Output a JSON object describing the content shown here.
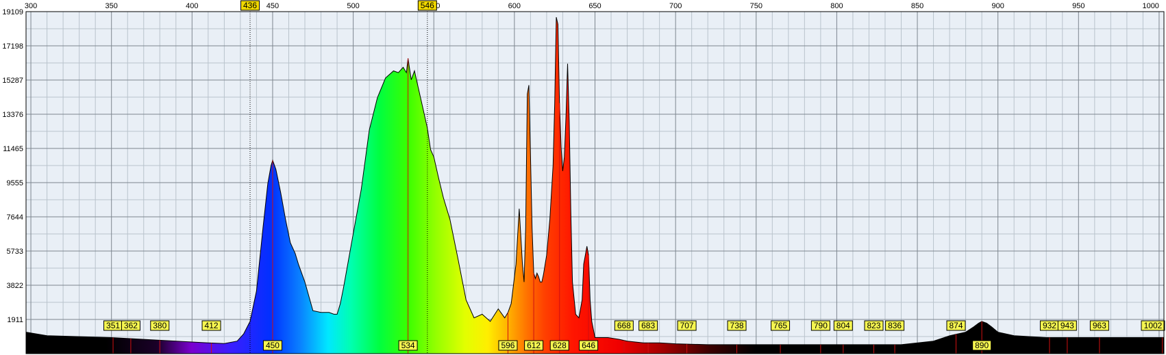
{
  "chart_data": {
    "type": "area",
    "title": "",
    "xlabel": "",
    "ylabel": "",
    "xlim": [
      297,
      1003
    ],
    "ylim": [
      0,
      19109
    ],
    "x_ticks": [
      "300",
      "350",
      "400",
      "450",
      "500",
      "550",
      "600",
      "650",
      "700",
      "750",
      "800",
      "850",
      "900",
      "950",
      "1000"
    ],
    "x_tick_values": [
      300,
      350,
      400,
      450,
      500,
      550,
      600,
      650,
      700,
      750,
      800,
      850,
      900,
      950,
      1000
    ],
    "y_ticks": [
      "1911",
      "3822",
      "5733",
      "7644",
      "9555",
      "11465",
      "13376",
      "15287",
      "17198",
      "19109"
    ],
    "y_tick_values": [
      1911,
      3822,
      5733,
      7644,
      9555,
      11465,
      13376,
      15287,
      17198,
      19109
    ],
    "grid": true,
    "markers": [
      {
        "label": "436",
        "x": 436
      },
      {
        "label": "546",
        "x": 546
      }
    ],
    "peak_labels": [
      {
        "label": "351",
        "x": 351,
        "row": "top"
      },
      {
        "label": "362",
        "x": 362,
        "row": "top"
      },
      {
        "label": "380",
        "x": 380,
        "row": "top"
      },
      {
        "label": "412",
        "x": 412,
        "row": "top"
      },
      {
        "label": "450",
        "x": 450,
        "row": "bottom"
      },
      {
        "label": "534",
        "x": 534,
        "row": "bottom"
      },
      {
        "label": "596",
        "x": 596,
        "row": "bottom"
      },
      {
        "label": "612",
        "x": 612,
        "row": "bottom"
      },
      {
        "label": "628",
        "x": 628,
        "row": "bottom"
      },
      {
        "label": "646",
        "x": 646,
        "row": "bottom"
      },
      {
        "label": "668",
        "x": 668,
        "row": "top"
      },
      {
        "label": "683",
        "x": 683,
        "row": "top"
      },
      {
        "label": "707",
        "x": 707,
        "row": "top"
      },
      {
        "label": "738",
        "x": 738,
        "row": "top"
      },
      {
        "label": "765",
        "x": 765,
        "row": "top"
      },
      {
        "label": "790",
        "x": 790,
        "row": "top"
      },
      {
        "label": "804",
        "x": 804,
        "row": "top"
      },
      {
        "label": "823",
        "x": 823,
        "row": "top"
      },
      {
        "label": "836",
        "x": 836,
        "row": "top"
      },
      {
        "label": "874",
        "x": 874,
        "row": "top"
      },
      {
        "label": "890",
        "x": 890,
        "row": "bottom"
      },
      {
        "label": "932",
        "x": 932,
        "row": "top"
      },
      {
        "label": "943",
        "x": 943,
        "row": "top"
      },
      {
        "label": "963",
        "x": 963,
        "row": "top"
      },
      {
        "label": "1002",
        "x": 1002,
        "row": "top"
      }
    ],
    "series": [
      {
        "x": [
          297,
          310,
          330,
          350,
          370,
          390,
          410,
          420,
          428,
          432,
          436,
          440,
          444,
          447,
          449,
          450,
          452,
          455,
          458,
          461,
          464,
          466,
          468,
          470,
          475,
          480,
          485,
          488,
          490,
          492,
          494,
          496,
          500,
          505,
          510,
          515,
          520,
          525,
          528,
          531,
          533,
          534,
          536,
          538,
          540,
          543,
          546,
          548,
          550,
          553,
          556,
          560,
          565,
          570,
          575,
          580,
          585,
          590,
          594,
          596,
          598,
          601,
          603,
          605,
          606,
          607,
          608,
          609,
          610,
          611,
          612,
          613,
          614,
          615,
          616,
          617,
          618,
          620,
          622,
          624,
          625,
          626,
          627,
          628,
          629,
          630,
          631,
          632,
          633,
          634,
          635,
          636,
          638,
          640,
          642,
          643,
          644,
          645,
          646,
          647,
          648,
          650,
          653,
          658,
          665,
          670,
          680,
          690,
          700,
          720,
          740,
          760,
          780,
          800,
          820,
          840,
          860,
          870,
          880,
          885,
          888,
          890,
          893,
          896,
          900,
          910,
          930,
          950,
          970,
          990,
          1003
        ],
        "y": [
          1200,
          1000,
          950,
          900,
          800,
          700,
          600,
          560,
          700,
          1100,
          1800,
          3500,
          7000,
          9500,
          10500,
          10800,
          10300,
          9000,
          7500,
          6200,
          5600,
          5000,
          4500,
          4000,
          2400,
          2300,
          2300,
          2200,
          2200,
          2800,
          3700,
          4700,
          6700,
          9200,
          12500,
          14300,
          15400,
          15800,
          15700,
          16000,
          15700,
          16500,
          15300,
          15800,
          15000,
          13800,
          12600,
          11400,
          11000,
          9800,
          8700,
          7500,
          5300,
          3000,
          2000,
          2200,
          1800,
          2500,
          2000,
          2300,
          2800,
          5000,
          8100,
          5000,
          4000,
          7000,
          14500,
          15000,
          11000,
          7000,
          4500,
          4200,
          4500,
          4300,
          4000,
          4000,
          4400,
          5500,
          7500,
          10500,
          14000,
          18800,
          18400,
          14000,
          11500,
          10200,
          11000,
          13300,
          16200,
          13000,
          8000,
          4000,
          2200,
          2000,
          3000,
          5000,
          5500,
          6000,
          5500,
          3000,
          1800,
          900,
          900,
          900,
          800,
          700,
          600,
          600,
          550,
          500,
          500,
          500,
          500,
          500,
          500,
          500,
          700,
          1000,
          1200,
          1500,
          1700,
          1800,
          1700,
          1500,
          1200,
          1000,
          900,
          900,
          900,
          900,
          900
        ]
      }
    ]
  }
}
